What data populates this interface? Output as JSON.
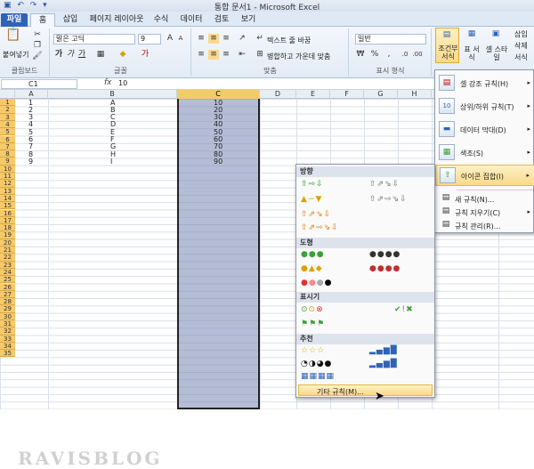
{
  "window": {
    "title": "통합 문서1 - Microsoft Excel",
    "quick_access": "▣ ↶ ↷ ▾"
  },
  "tabs": [
    "파일",
    "홈",
    "삽입",
    "페이지 레이아웃",
    "수식",
    "데이터",
    "검토",
    "보기"
  ],
  "ribbon": {
    "clipboard": {
      "label": "클립보드",
      "paste": "붙여넣기"
    },
    "font": {
      "label": "글꼴",
      "name": "맑은 고딕",
      "size": "9",
      "bold": "가",
      "italic": "가",
      "underline": "가"
    },
    "align": {
      "label": "맞춤",
      "wrap": "텍스트 줄 바꿈",
      "merge": "병합하고 가운데 맞춤"
    },
    "number": {
      "label": "표시 형식",
      "format": "일반"
    },
    "styles": {
      "cond": "조건부 서식",
      "table": "표 서식",
      "cell": "셀 스타일"
    },
    "right": {
      "insert": "삽입",
      "delete": "삭제",
      "format": "서식"
    }
  },
  "formula_bar": {
    "name_box": "C1",
    "fx": "fx",
    "value": "10"
  },
  "columns": [
    "A",
    "B",
    "C",
    "D",
    "E",
    "F",
    "G",
    "H"
  ],
  "rows": [
    "1",
    "2",
    "3",
    "4",
    "5",
    "6",
    "7",
    "8",
    "9",
    "10",
    "11",
    "12",
    "13",
    "14",
    "15",
    "16",
    "17",
    "18",
    "19",
    "20",
    "21",
    "22",
    "23",
    "24",
    "25",
    "26",
    "27",
    "28",
    "29",
    "30",
    "31",
    "32",
    "33",
    "34",
    "35"
  ],
  "data": {
    "colA": [
      "1",
      "2",
      "3",
      "4",
      "5",
      "6",
      "7",
      "8",
      "9"
    ],
    "colB": [
      "A",
      "B",
      "C",
      "D",
      "E",
      "F",
      "G",
      "H",
      "I"
    ],
    "colC": [
      "10",
      "20",
      "30",
      "40",
      "50",
      "60",
      "70",
      "80",
      "90"
    ]
  },
  "cond_menu": [
    {
      "label": "셀 강조 규칙(H)",
      "arrow": "▸"
    },
    {
      "label": "상위/하위 규칙(T)",
      "arrow": "▸"
    },
    {
      "label": "데이터 막대(D)",
      "arrow": "▸"
    },
    {
      "label": "색조(S)",
      "arrow": "▸"
    },
    {
      "label": "아이콘 집합(I)",
      "arrow": "▸"
    },
    {
      "label": "새 규칙(N)..."
    },
    {
      "label": "규칙 지우기(C)",
      "arrow": "▸"
    },
    {
      "label": "규칙 관리(R)..."
    }
  ],
  "icon_sets": {
    "sections": [
      "방향",
      "도형",
      "표시기",
      "추천"
    ],
    "direction": [
      "⇧⇨⇩",
      "⇧⇗⇘⇩",
      "▲−▼",
      "⇧⇗⇨⇘⇩",
      "⇧⇗⇘⇩",
      "⇧⇗⇨⇘⇩"
    ],
    "shapes": [
      "●●●",
      "●●●●",
      "●▲◆",
      "●●●●"
    ],
    "indicators": [
      "✔!✖",
      "⚑⚑⚑"
    ],
    "ratings": [
      "☆☆☆",
      "▂▄▆█",
      "◔◑◕●",
      "▂▄▆█",
      "▦▦▦▦"
    ],
    "more": "기타 규칙(M)..."
  },
  "watermark": "RAVISBLOG",
  "colors": {
    "accent": "#2f63b7",
    "selection": "#f6c96a",
    "highlight": "#f9d98a"
  }
}
